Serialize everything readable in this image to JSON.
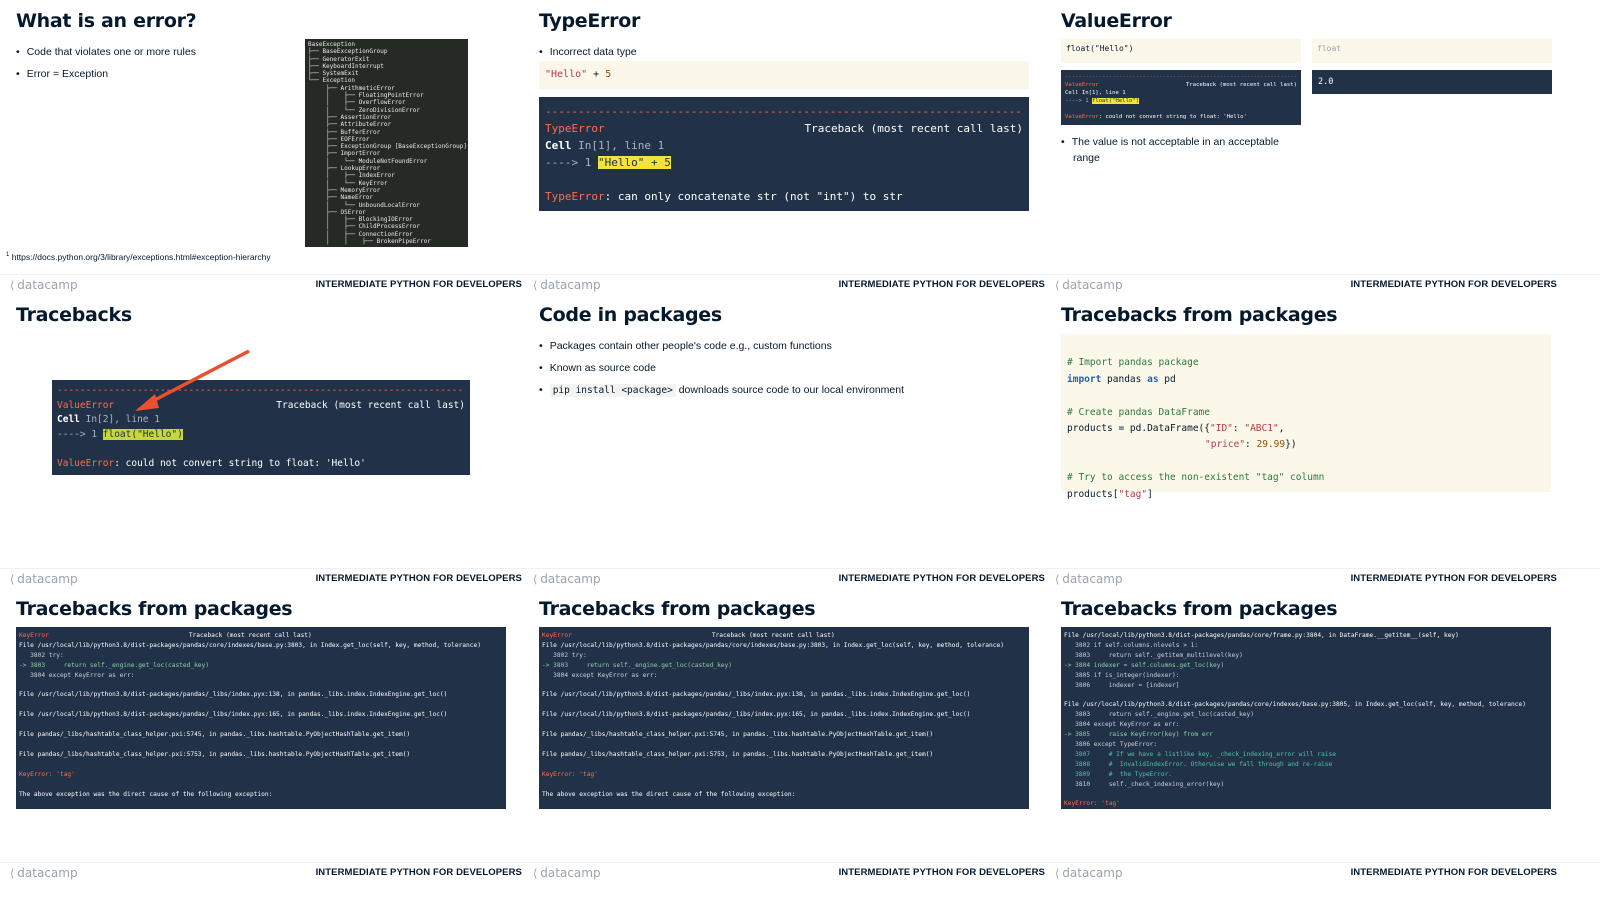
{
  "course_title": "INTERMEDIATE PYTHON FOR DEVELOPERS",
  "brand": "datacamp",
  "brand_mark": "⟨",
  "slides": [
    {
      "title": "What is an error?",
      "bullets": [
        "Code that violates one or more rules",
        "Error = Exception"
      ],
      "footnote_mark": "1",
      "footnote": "https://docs.python.org/3/library/exceptions.html#exception-hierarchy",
      "tree": [
        "BaseException",
        "├── BaseExceptionGroup",
        "├── GeneratorExit",
        "├── KeyboardInterrupt",
        "├── SystemExit",
        "└── Exception",
        "     ├── ArithmeticError",
        "     │    ├── FloatingPointError",
        "     │    ├── OverflowError",
        "     │    └── ZeroDivisionError",
        "     ├── AssertionError",
        "     ├── AttributeError",
        "     ├── BufferError",
        "     ├── EOFError",
        "     ├── ExceptionGroup [BaseExceptionGroup]",
        "     ├── ImportError",
        "     │    └── ModuleNotFoundError",
        "     ├── LookupError",
        "     │    ├── IndexError",
        "     │    └── KeyError",
        "     ├── MemoryError",
        "     ├── NameError",
        "     │    └── UnboundLocalError",
        "     ├── OSError",
        "     │    ├── BlockingIOError",
        "     │    ├── ChildProcessError",
        "     │    ├── ConnectionError",
        "     │    │    ├── BrokenPipeError"
      ]
    },
    {
      "title": "TypeError",
      "bullets": [
        "Incorrect data type"
      ],
      "code_str": "\"Hello\"",
      "code_rest": " + ",
      "code_num": "5",
      "dashes": "----------------------------------------------------------------------------",
      "err_name": "TypeError",
      "traceback_label": "Traceback (most recent call last)",
      "cell_word": "Cell",
      "cell_rest": " In[1], line 1",
      "arrow": "----> 1 ",
      "hl_code": "\"Hello\" + 5",
      "err_msg": ": can only concatenate str (not \"int\") to str"
    },
    {
      "title": "ValueError",
      "code": "float(\"Hello\")",
      "code2": "float",
      "output": "2.0",
      "mini_err": "ValueError",
      "mini_tb": "Traceback (most recent call last)",
      "mini_cell": "Cell In[1], line 1",
      "mini_arrow": "----> 1 ",
      "mini_hl": "float(\"Hello\")",
      "mini_msg": ": could not convert string to float: 'Hello'",
      "bullets": [
        "The value is not acceptable in an acceptable range"
      ]
    },
    {
      "title": "Tracebacks",
      "err_name": "ValueError",
      "traceback_label": "Traceback (most recent call last)",
      "cell_word": "Cell",
      "cell_rest": " In[2], line 1",
      "arrow": "----> 1 ",
      "hl_code": "float(\"Hello\")",
      "err_msg": ": could not convert string to float: 'Hello'"
    },
    {
      "title": "Code in packages",
      "bullets": [
        "Packages contain other people's code e.g., custom functions",
        "Known as source code"
      ],
      "pip_code": "pip install <package>",
      "pip_rest": " downloads source code to our local environment"
    },
    {
      "title": "Tracebacks from packages",
      "c1": "# Import pandas package",
      "kw_import": "import",
      "pd1": " pandas ",
      "kw_as": "as",
      "pd2": " pd",
      "c2": "# Create pandas DataFrame",
      "df1": "products = pd.DataFrame({",
      "s_id": "\"ID\"",
      "colon1": ": ",
      "s_abc": "\"ABC1\"",
      "comma": ",",
      "s_price": "\"price\"",
      "colon2": ": ",
      "n_price": "29.99",
      "close": "})",
      "c3": "# Try to access the non-existent \"tag\" column",
      "p1": "products[",
      "s_tag": "\"tag\"",
      "p2": "]"
    },
    {
      "title": "Tracebacks from packages",
      "lines": [
        {
          "k": "err",
          "t": "KeyError"
        },
        {
          "k": "f",
          "t": "File /usr/local/lib/python3.8/dist-packages/pandas/core/indexes/base.py:3803, in Index.get_loc(self, key, method, tolerance)"
        },
        {
          "k": "n",
          "t": "   3802 try:"
        },
        {
          "k": "h",
          "t": "-> 3803     return self._engine.get_loc(casted_key)"
        },
        {
          "k": "n",
          "t": "   3804 except KeyError as err:"
        },
        {
          "k": "b",
          "t": ""
        },
        {
          "k": "f",
          "t": "File /usr/local/lib/python3.8/dist-packages/pandas/_libs/index.pyx:138, in pandas._libs.index.IndexEngine.get_loc()"
        },
        {
          "k": "b",
          "t": ""
        },
        {
          "k": "f",
          "t": "File /usr/local/lib/python3.8/dist-packages/pandas/_libs/index.pyx:165, in pandas._libs.index.IndexEngine.get_loc()"
        },
        {
          "k": "b",
          "t": ""
        },
        {
          "k": "f",
          "t": "File pandas/_libs/hashtable_class_helper.pxi:5745, in pandas._libs.hashtable.PyObjectHashTable.get_item()"
        },
        {
          "k": "b",
          "t": ""
        },
        {
          "k": "f",
          "t": "File pandas/_libs/hashtable_class_helper.pxi:5753, in pandas._libs.hashtable.PyObjectHashTable.get_item()"
        },
        {
          "k": "b",
          "t": ""
        },
        {
          "k": "e",
          "t": "KeyError: 'tag'"
        },
        {
          "k": "b",
          "t": ""
        },
        {
          "k": "w",
          "t": "The above exception was the direct cause of the following exception:"
        }
      ]
    },
    {
      "title": "Tracebacks from packages"
    },
    {
      "title": "Tracebacks from packages",
      "lines": [
        {
          "k": "f",
          "t": "File /usr/local/lib/python3.8/dist-packages/pandas/core/frame.py:3804, in DataFrame.__getitem__(self, key)"
        },
        {
          "k": "n",
          "t": "   3802 if self.columns.nlevels > 1:"
        },
        {
          "k": "n",
          "t": "   3803     return self._getitem_multilevel(key)"
        },
        {
          "k": "h",
          "t": "-> 3804 indexer = self.columns.get_loc(key)"
        },
        {
          "k": "n",
          "t": "   3805 if is_integer(indexer):"
        },
        {
          "k": "n",
          "t": "   3806     indexer = [indexer]"
        },
        {
          "k": "b",
          "t": ""
        },
        {
          "k": "f",
          "t": "File /usr/local/lib/python3.8/dist-packages/pandas/core/indexes/base.py:3805, in Index.get_loc(self, key, method, tolerance)"
        },
        {
          "k": "n",
          "t": "   3803     return self._engine.get_loc(casted_key)"
        },
        {
          "k": "n",
          "t": "   3804 except KeyError as err:"
        },
        {
          "k": "a",
          "t": "-> 3805     raise KeyError(key) from err"
        },
        {
          "k": "n",
          "t": "   3806 except TypeError:"
        },
        {
          "k": "c",
          "t": "   3807     # If we have a listlike key, _check_indexing_error will raise"
        },
        {
          "k": "c",
          "t": "   3808     #  InvalidIndexError. Otherwise we fall through and re-raise"
        },
        {
          "k": "c",
          "t": "   3809     #  the TypeError."
        },
        {
          "k": "n",
          "t": "   3810     self._check_indexing_error(key)"
        },
        {
          "k": "b",
          "t": ""
        },
        {
          "k": "e",
          "t": "KeyError: 'tag'"
        }
      ]
    }
  ]
}
